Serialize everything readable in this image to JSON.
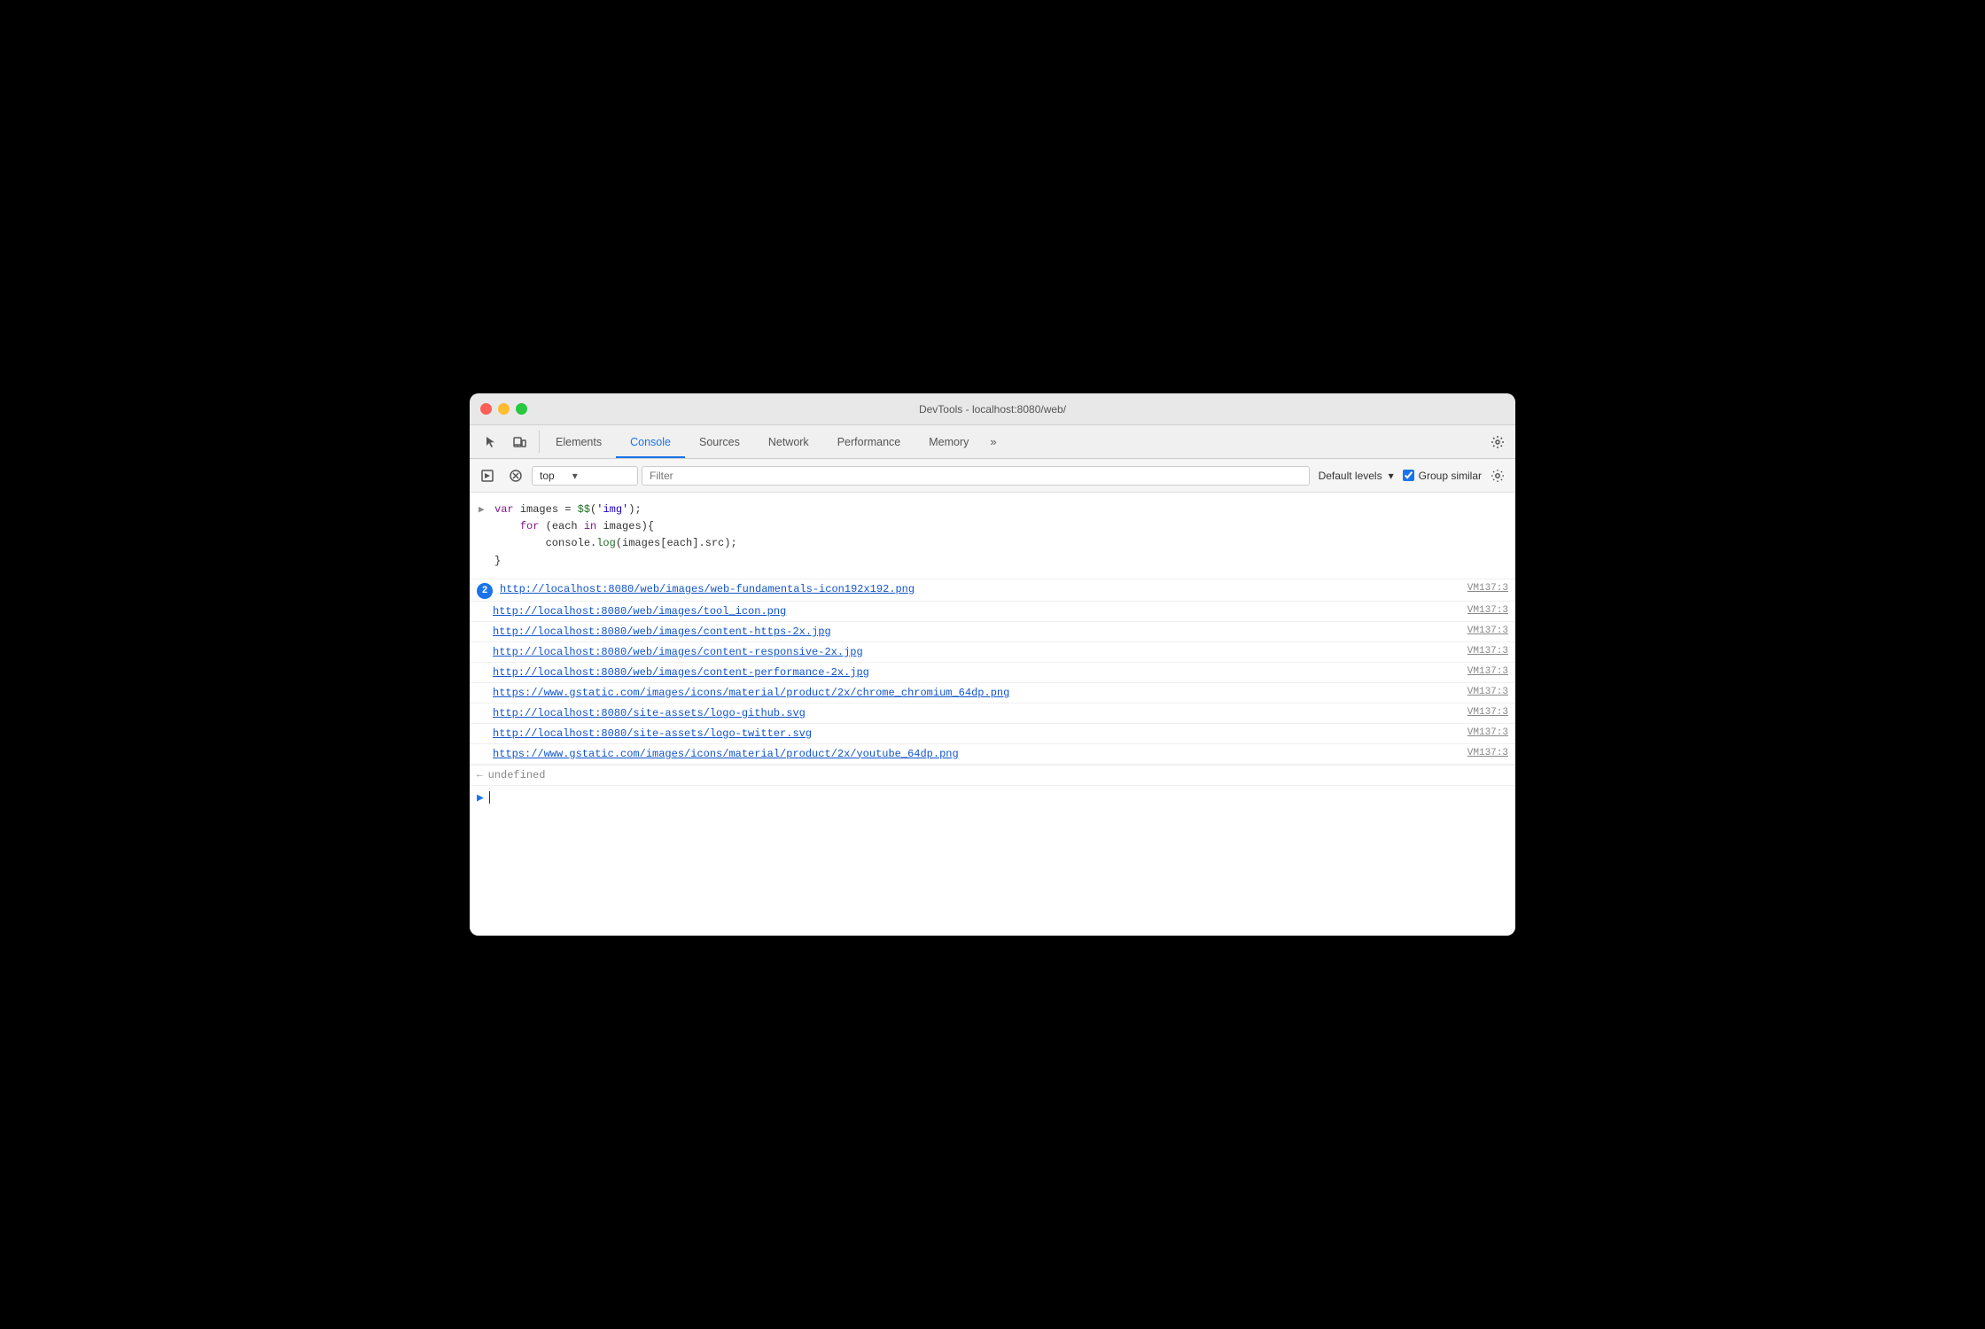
{
  "window": {
    "title": "DevTools - localhost:8080/web/"
  },
  "tabs": [
    {
      "id": "elements",
      "label": "Elements",
      "active": false
    },
    {
      "id": "console",
      "label": "Console",
      "active": true
    },
    {
      "id": "sources",
      "label": "Sources",
      "active": false
    },
    {
      "id": "network",
      "label": "Network",
      "active": false
    },
    {
      "id": "performance",
      "label": "Performance",
      "active": false
    },
    {
      "id": "memory",
      "label": "Memory",
      "active": false
    }
  ],
  "toolbar": {
    "context_value": "top",
    "filter_placeholder": "Filter",
    "levels_label": "Default levels",
    "group_similar_label": "Group similar",
    "group_similar_checked": true
  },
  "console": {
    "code": [
      "var images = $$('img');",
      "for (each in images){",
      "        console.log(images[each].src);",
      "}"
    ],
    "log_entries": [
      {
        "url": "http://localhost:8080/web/images/web-fundamentals-icon192x192.png",
        "source": "VM137:3",
        "badge": "2",
        "first": true
      },
      {
        "url": "http://localhost:8080/web/images/tool_icon.png",
        "source": "VM137:3",
        "first": false
      },
      {
        "url": "http://localhost:8080/web/images/content-https-2x.jpg",
        "source": "VM137:3",
        "first": false
      },
      {
        "url": "http://localhost:8080/web/images/content-responsive-2x.jpg",
        "source": "VM137:3",
        "first": false
      },
      {
        "url": "http://localhost:8080/web/images/content-performance-2x.jpg",
        "source": "VM137:3",
        "first": false
      },
      {
        "url": "https://www.gstatic.com/images/icons/material/product/2x/chrome_chromium_64dp.png",
        "source": "VM137:3",
        "first": false
      },
      {
        "url": "http://localhost:8080/site-assets/logo-github.svg",
        "source": "VM137:3",
        "first": false
      },
      {
        "url": "http://localhost:8080/site-assets/logo-twitter.svg",
        "source": "VM137:3",
        "first": false
      },
      {
        "url": "https://www.gstatic.com/images/icons/material/product/2x/youtube_64dp.png",
        "source": "VM137:3",
        "first": false
      }
    ],
    "undefined_label": "undefined",
    "return_arrow": "←"
  }
}
